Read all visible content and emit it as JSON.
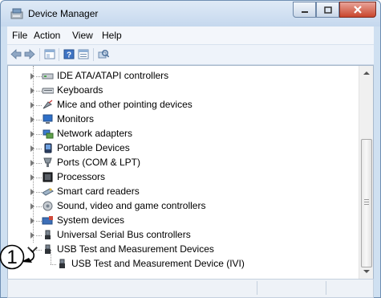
{
  "window": {
    "title": "Device Manager"
  },
  "menu": [
    "File",
    "Action",
    "View",
    "Help"
  ],
  "tree": {
    "items": [
      {
        "label": "IDE ATA/ATAPI controllers",
        "icon": "ide-controller-icon"
      },
      {
        "label": "Keyboards",
        "icon": "keyboard-icon"
      },
      {
        "label": "Mice and other pointing devices",
        "icon": "mouse-icon"
      },
      {
        "label": "Monitors",
        "icon": "monitor-icon"
      },
      {
        "label": "Network adapters",
        "icon": "network-adapter-icon"
      },
      {
        "label": "Portable Devices",
        "icon": "portable-device-icon"
      },
      {
        "label": "Ports (COM & LPT)",
        "icon": "port-icon"
      },
      {
        "label": "Processors",
        "icon": "processor-icon"
      },
      {
        "label": "Smart card readers",
        "icon": "smart-card-icon"
      },
      {
        "label": "Sound, video and game controllers",
        "icon": "sound-icon"
      },
      {
        "label": "System devices",
        "icon": "system-device-icon"
      },
      {
        "label": "Universal Serial Bus controllers",
        "icon": "usb-controller-icon"
      },
      {
        "label": "USB Test and Measurement Devices",
        "icon": "usb-plug-icon"
      },
      {
        "label": "USB Test and Measurement Device (IVI)",
        "icon": "usb-plug-icon"
      }
    ]
  },
  "callout": {
    "number": "1"
  }
}
